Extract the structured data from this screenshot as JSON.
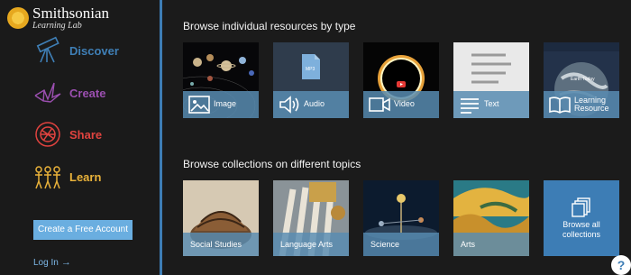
{
  "brand": {
    "title": "Smithsonian",
    "subtitle": "Learning Lab"
  },
  "nav": {
    "discover": "Discover",
    "create": "Create",
    "share": "Share",
    "learn": "Learn"
  },
  "account": {
    "create_label": "Create a Free Account",
    "login_label": "Log In",
    "login_arrow": "→"
  },
  "sections": {
    "types_title": "Browse individual resources by type",
    "collections_title": "Browse collections on different topics"
  },
  "resource_types": [
    {
      "label": "Image",
      "icon": "image-icon"
    },
    {
      "label": "Audio",
      "icon": "speaker-icon"
    },
    {
      "label": "Video",
      "icon": "video-camera-icon"
    },
    {
      "label": "Text",
      "icon": "text-lines-icon"
    },
    {
      "label": "Learning Resource",
      "icon": "open-book-icon"
    }
  ],
  "thumb_text": {
    "audio_file": "MP3",
    "earth_today": "Earth Today"
  },
  "collections": [
    {
      "label": "Social Studies"
    },
    {
      "label": "Language Arts"
    },
    {
      "label": "Science"
    },
    {
      "label": "Arts"
    },
    {
      "label": "Browse all collections",
      "icon": "stack-icon"
    }
  ],
  "help": {
    "label": "?"
  },
  "colors": {
    "accent": "#3d7db5",
    "discover": "#3f7fb6",
    "create": "#9b4fb0",
    "share": "#e0433f",
    "learn": "#e9b23a"
  }
}
